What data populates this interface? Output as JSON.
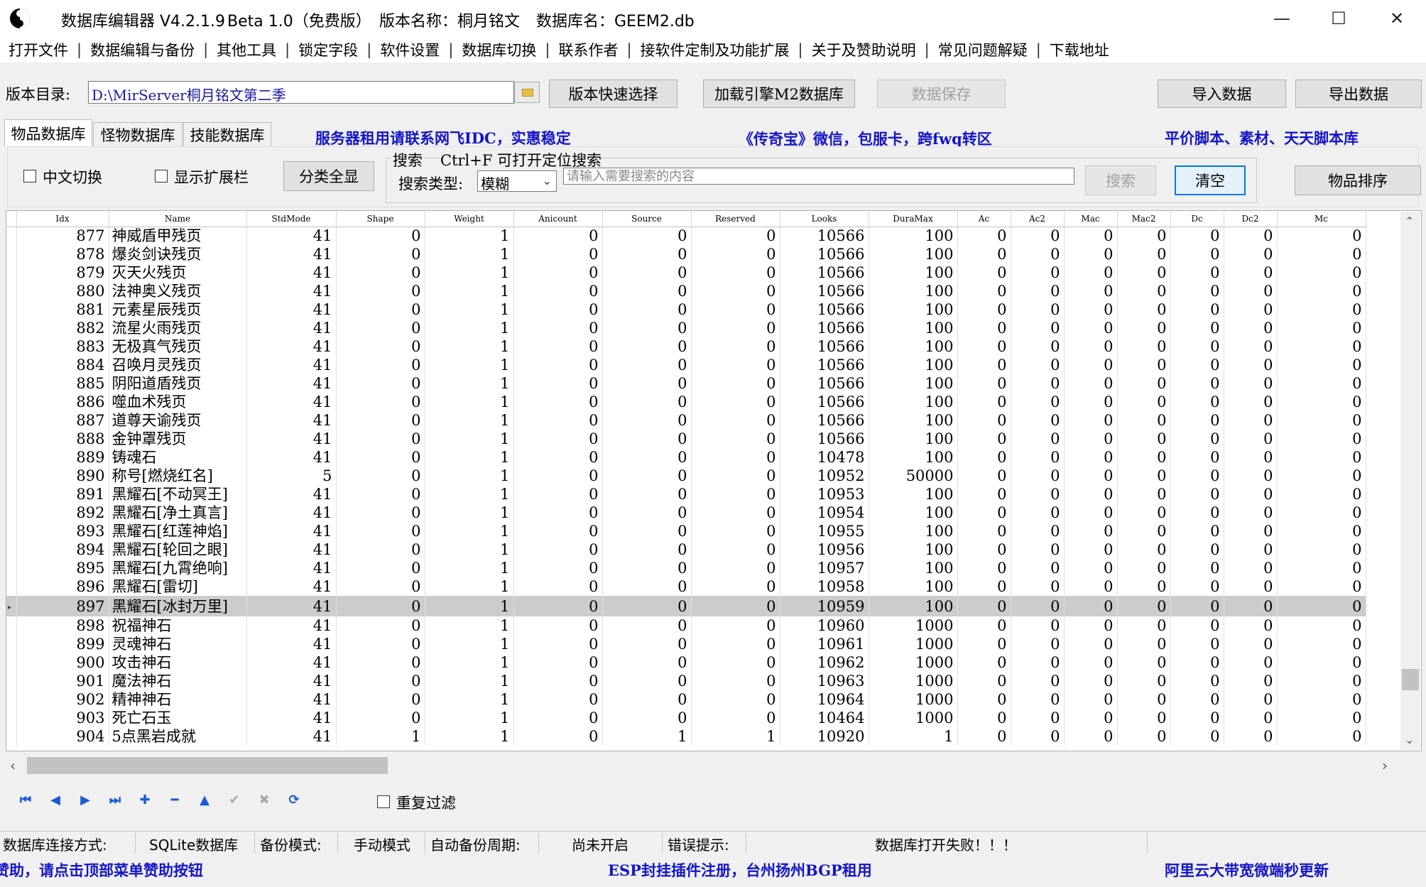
{
  "window": {
    "title_app": "数据库编辑器 V4.2.1.9",
    "title_beta": "Beta 1.0（免费版）",
    "title_version": "版本名称：桐月铭文",
    "title_db": "数据库名：GEEM2.db",
    "minimize": "—",
    "maximize": "☐",
    "close": "✕"
  },
  "menu": [
    "打开文件",
    "数据编辑与备份",
    "其他工具",
    "锁定字段",
    "软件设置",
    "数据库切换",
    "联系作者",
    "接软件定制及功能扩展",
    "关于及赞助说明",
    "常见问题解疑",
    "下载地址"
  ],
  "toolbar": {
    "dir_label": "版本目录:",
    "dir_value": "D:\\MirServer桐月铭文第二季",
    "quick_select": "版本快速选择",
    "load_engine": "加载引擎M2数据库",
    "save": "数据保存",
    "import": "导入数据",
    "export": "导出数据"
  },
  "tabs": [
    "物品数据库",
    "怪物数据库",
    "技能数据库"
  ],
  "promos": {
    "p1": "服务器租用请联系网飞IDC，实惠稳定",
    "p2": "《传奇宝》微信，包服卡，跨fwq转区",
    "p3": "平价脚本、素材、天天脚本库"
  },
  "filter": {
    "cn_switch": "中文切换",
    "show_ext": "显示扩展栏",
    "show_all": "分类全显",
    "search_title": "搜索",
    "search_hint": "Ctrl+F 可打开定位搜索",
    "search_type_label": "搜索类型:",
    "search_type_value": "模糊",
    "search_placeholder": "请输入需要搜索的内容",
    "search_btn": "搜索",
    "clear_btn": "清空",
    "sort_btn": "物品排序"
  },
  "grid": {
    "columns": [
      "Idx",
      "Name",
      "StdMode",
      "Shape",
      "Weight",
      "Anicount",
      "Source",
      "Reserved",
      "Looks",
      "DuraMax",
      "Ac",
      "Ac2",
      "Mac",
      "Mac2",
      "Dc",
      "Dc2",
      "Mc"
    ],
    "selected_idx": "897",
    "rows": [
      [
        "877",
        "神威盾甲残页",
        "41",
        "0",
        "1",
        "0",
        "0",
        "0",
        "10566",
        "100",
        "0",
        "0",
        "0",
        "0",
        "0",
        "0",
        "0"
      ],
      [
        "878",
        "爆炎剑诀残页",
        "41",
        "0",
        "1",
        "0",
        "0",
        "0",
        "10566",
        "100",
        "0",
        "0",
        "0",
        "0",
        "0",
        "0",
        "0"
      ],
      [
        "879",
        "灭天火残页",
        "41",
        "0",
        "1",
        "0",
        "0",
        "0",
        "10566",
        "100",
        "0",
        "0",
        "0",
        "0",
        "0",
        "0",
        "0"
      ],
      [
        "880",
        "法神奥义残页",
        "41",
        "0",
        "1",
        "0",
        "0",
        "0",
        "10566",
        "100",
        "0",
        "0",
        "0",
        "0",
        "0",
        "0",
        "0"
      ],
      [
        "881",
        "元素星辰残页",
        "41",
        "0",
        "1",
        "0",
        "0",
        "0",
        "10566",
        "100",
        "0",
        "0",
        "0",
        "0",
        "0",
        "0",
        "0"
      ],
      [
        "882",
        "流星火雨残页",
        "41",
        "0",
        "1",
        "0",
        "0",
        "0",
        "10566",
        "100",
        "0",
        "0",
        "0",
        "0",
        "0",
        "0",
        "0"
      ],
      [
        "883",
        "无极真气残页",
        "41",
        "0",
        "1",
        "0",
        "0",
        "0",
        "10566",
        "100",
        "0",
        "0",
        "0",
        "0",
        "0",
        "0",
        "0"
      ],
      [
        "884",
        "召唤月灵残页",
        "41",
        "0",
        "1",
        "0",
        "0",
        "0",
        "10566",
        "100",
        "0",
        "0",
        "0",
        "0",
        "0",
        "0",
        "0"
      ],
      [
        "885",
        "阴阳道盾残页",
        "41",
        "0",
        "1",
        "0",
        "0",
        "0",
        "10566",
        "100",
        "0",
        "0",
        "0",
        "0",
        "0",
        "0",
        "0"
      ],
      [
        "886",
        "噬血术残页",
        "41",
        "0",
        "1",
        "0",
        "0",
        "0",
        "10566",
        "100",
        "0",
        "0",
        "0",
        "0",
        "0",
        "0",
        "0"
      ],
      [
        "887",
        "道尊天谕残页",
        "41",
        "0",
        "1",
        "0",
        "0",
        "0",
        "10566",
        "100",
        "0",
        "0",
        "0",
        "0",
        "0",
        "0",
        "0"
      ],
      [
        "888",
        "金钟罩残页",
        "41",
        "0",
        "1",
        "0",
        "0",
        "0",
        "10566",
        "100",
        "0",
        "0",
        "0",
        "0",
        "0",
        "0",
        "0"
      ],
      [
        "889",
        "铸魂石",
        "41",
        "0",
        "1",
        "0",
        "0",
        "0",
        "10478",
        "100",
        "0",
        "0",
        "0",
        "0",
        "0",
        "0",
        "0"
      ],
      [
        "890",
        "称号[燃烧红名]",
        "5",
        "0",
        "1",
        "0",
        "0",
        "0",
        "10952",
        "50000",
        "0",
        "0",
        "0",
        "0",
        "0",
        "0",
        "0"
      ],
      [
        "891",
        "黑耀石[不动冥王]",
        "41",
        "0",
        "1",
        "0",
        "0",
        "0",
        "10953",
        "100",
        "0",
        "0",
        "0",
        "0",
        "0",
        "0",
        "0"
      ],
      [
        "892",
        "黑耀石[净土真言]",
        "41",
        "0",
        "1",
        "0",
        "0",
        "0",
        "10954",
        "100",
        "0",
        "0",
        "0",
        "0",
        "0",
        "0",
        "0"
      ],
      [
        "893",
        "黑耀石[红莲神焰]",
        "41",
        "0",
        "1",
        "0",
        "0",
        "0",
        "10955",
        "100",
        "0",
        "0",
        "0",
        "0",
        "0",
        "0",
        "0"
      ],
      [
        "894",
        "黑耀石[轮回之眼]",
        "41",
        "0",
        "1",
        "0",
        "0",
        "0",
        "10956",
        "100",
        "0",
        "0",
        "0",
        "0",
        "0",
        "0",
        "0"
      ],
      [
        "895",
        "黑耀石[九霄绝响]",
        "41",
        "0",
        "1",
        "0",
        "0",
        "0",
        "10957",
        "100",
        "0",
        "0",
        "0",
        "0",
        "0",
        "0",
        "0"
      ],
      [
        "896",
        "黑耀石[雷切]",
        "41",
        "0",
        "1",
        "0",
        "0",
        "0",
        "10958",
        "100",
        "0",
        "0",
        "0",
        "0",
        "0",
        "0",
        "0"
      ],
      [
        "897",
        "黑耀石[冰封万里]",
        "41",
        "0",
        "1",
        "0",
        "0",
        "0",
        "10959",
        "100",
        "0",
        "0",
        "0",
        "0",
        "0",
        "0",
        "0"
      ],
      [
        "898",
        "祝福神石",
        "41",
        "0",
        "1",
        "0",
        "0",
        "0",
        "10960",
        "1000",
        "0",
        "0",
        "0",
        "0",
        "0",
        "0",
        "0"
      ],
      [
        "899",
        "灵魂神石",
        "41",
        "0",
        "1",
        "0",
        "0",
        "0",
        "10961",
        "1000",
        "0",
        "0",
        "0",
        "0",
        "0",
        "0",
        "0"
      ],
      [
        "900",
        "攻击神石",
        "41",
        "0",
        "1",
        "0",
        "0",
        "0",
        "10962",
        "1000",
        "0",
        "0",
        "0",
        "0",
        "0",
        "0",
        "0"
      ],
      [
        "901",
        "魔法神石",
        "41",
        "0",
        "1",
        "0",
        "0",
        "0",
        "10963",
        "1000",
        "0",
        "0",
        "0",
        "0",
        "0",
        "0",
        "0"
      ],
      [
        "902",
        "精神神石",
        "41",
        "0",
        "1",
        "0",
        "0",
        "0",
        "10964",
        "1000",
        "0",
        "0",
        "0",
        "0",
        "0",
        "0",
        "0"
      ],
      [
        "903",
        "死亡石玉",
        "41",
        "0",
        "1",
        "0",
        "0",
        "0",
        "10464",
        "1000",
        "0",
        "0",
        "0",
        "0",
        "0",
        "0",
        "0"
      ],
      [
        "904",
        "5点黑岩成就",
        "41",
        "1",
        "1",
        "0",
        "1",
        "1",
        "10920",
        "1",
        "0",
        "0",
        "0",
        "0",
        "0",
        "0",
        "0"
      ]
    ]
  },
  "navigator": {
    "repeat_filter": "重复过滤"
  },
  "status": {
    "conn_label": "数据库连接方式:",
    "conn_value": "SQLite数据库",
    "backup_label": "备份模式:",
    "backup_value": "手动模式",
    "auto_label": "自动备份周期:",
    "auto_value": "尚未开启",
    "err_label": "错误提示:",
    "err_value": "数据库打开失败！！！",
    "promo_left": "赞助，请点击顶部菜单赞助按钮",
    "promo_mid": "ESP封挂插件注册，台州扬州BGP租用",
    "promo_right": "阿里云大带宽微端秒更新"
  },
  "colors": {
    "promo_blue": "#1414c8",
    "nav_blue": "#1a5ad4",
    "selected_row": "#cccccc"
  }
}
